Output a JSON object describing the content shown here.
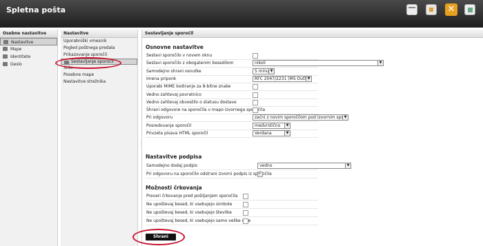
{
  "app": {
    "title": "Spletna pošta"
  },
  "toolbar": {
    "icons": [
      "window-icon",
      "folder-icon",
      "tools-icon",
      "logout-icon"
    ]
  },
  "personal_settings": {
    "header": "Osebne nastavitve",
    "items": [
      {
        "label": "Nastavitve",
        "icon": "settings-icon",
        "selected": true
      },
      {
        "label": "Mape",
        "icon": "folder-icon",
        "selected": false
      },
      {
        "label": "Identitete",
        "icon": "identity-icon",
        "selected": false
      },
      {
        "label": "Geslo",
        "icon": "key-icon",
        "selected": false
      }
    ]
  },
  "settings_nav": {
    "header": "Nastavitve",
    "items": [
      {
        "label": "Uporabniški vmesnik",
        "selected": false
      },
      {
        "label": "Pogled poštnega predala",
        "selected": false
      },
      {
        "label": "Prikazovanje sporočil",
        "selected": false
      },
      {
        "label": "Sestavljanje sporočil",
        "selected": true
      },
      {
        "label": "Stiki",
        "selected": false
      },
      {
        "label": "Posebne mape",
        "selected": false
      },
      {
        "label": "Nastavitve strežnika",
        "selected": false
      }
    ]
  },
  "main": {
    "header": "Sestavljanje sporočil",
    "sections": {
      "basic": {
        "title": "Osnovne nastavitve",
        "rows": [
          {
            "label": "Sestavi sporočilo v novem oknu",
            "type": "checkbox",
            "checked": false
          },
          {
            "label": "Sestavi sporočilo z obogatenim besedilom",
            "type": "select",
            "value": "nikoli",
            "width": "wide"
          },
          {
            "label": "Samodejno shrani osnutke",
            "type": "select",
            "value": "5 minut",
            "width": "small"
          },
          {
            "label": "Imena priponk",
            "type": "select",
            "value": "RFC 2047/2231 (MS Outlook)",
            "width": "medium"
          },
          {
            "label": "Uporabi MIME kodiranje za 8-bitne znake",
            "type": "checkbox",
            "checked": false
          },
          {
            "label": "Vedno zahtevaj povratnico",
            "type": "checkbox",
            "checked": false
          },
          {
            "label": "Vedno zahtevaj obvestilo o statusu dostave",
            "type": "checkbox",
            "checked": false
          },
          {
            "label": "Shrani odgovore na sporočila v mapo izvornega sporočila",
            "type": "checkbox",
            "checked": false
          },
          {
            "label": "Pri odgovoru",
            "type": "select",
            "value": "začni z novim sporočilom pod izvornim sporočilom",
            "width": "large"
          },
          {
            "label": "Posredovanje sporočil",
            "type": "select",
            "value": "medvrstično",
            "width": "mid"
          },
          {
            "label": "Privzeta pisava HTML sporočil",
            "type": "select",
            "value": "Verdana",
            "width": "mid"
          }
        ]
      },
      "signature": {
        "title": "Nastavitve podpisa",
        "rows": [
          {
            "label": "Samodejno dodaj podpis",
            "type": "select",
            "value": "vedno",
            "width": "xl"
          },
          {
            "label": "Pri odgovoru na sporočilo odstrani izvorni podpis iz sporočila",
            "type": "checkbox",
            "checked": true
          }
        ]
      },
      "spellcheck": {
        "title": "Možnosti črkovanja",
        "rows": [
          {
            "label": "Preveri črkovanje pred pošiljanjem sporočila",
            "type": "checkbox",
            "checked": false
          },
          {
            "label": "Ne upoštevaj besed, ki vsebujejo simbole",
            "type": "checkbox",
            "checked": false
          },
          {
            "label": "Ne upoštevaj besed, ki vsebujejo številke",
            "type": "checkbox",
            "checked": false
          },
          {
            "label": "Ne upoštevaj besed, ki vsebujejo samo velike črke",
            "type": "checkbox",
            "checked": false
          }
        ]
      }
    },
    "save_label": "Shrani"
  },
  "colors": {
    "highlight_ring": "#c8102e",
    "topbar": "#2b2b2b"
  }
}
